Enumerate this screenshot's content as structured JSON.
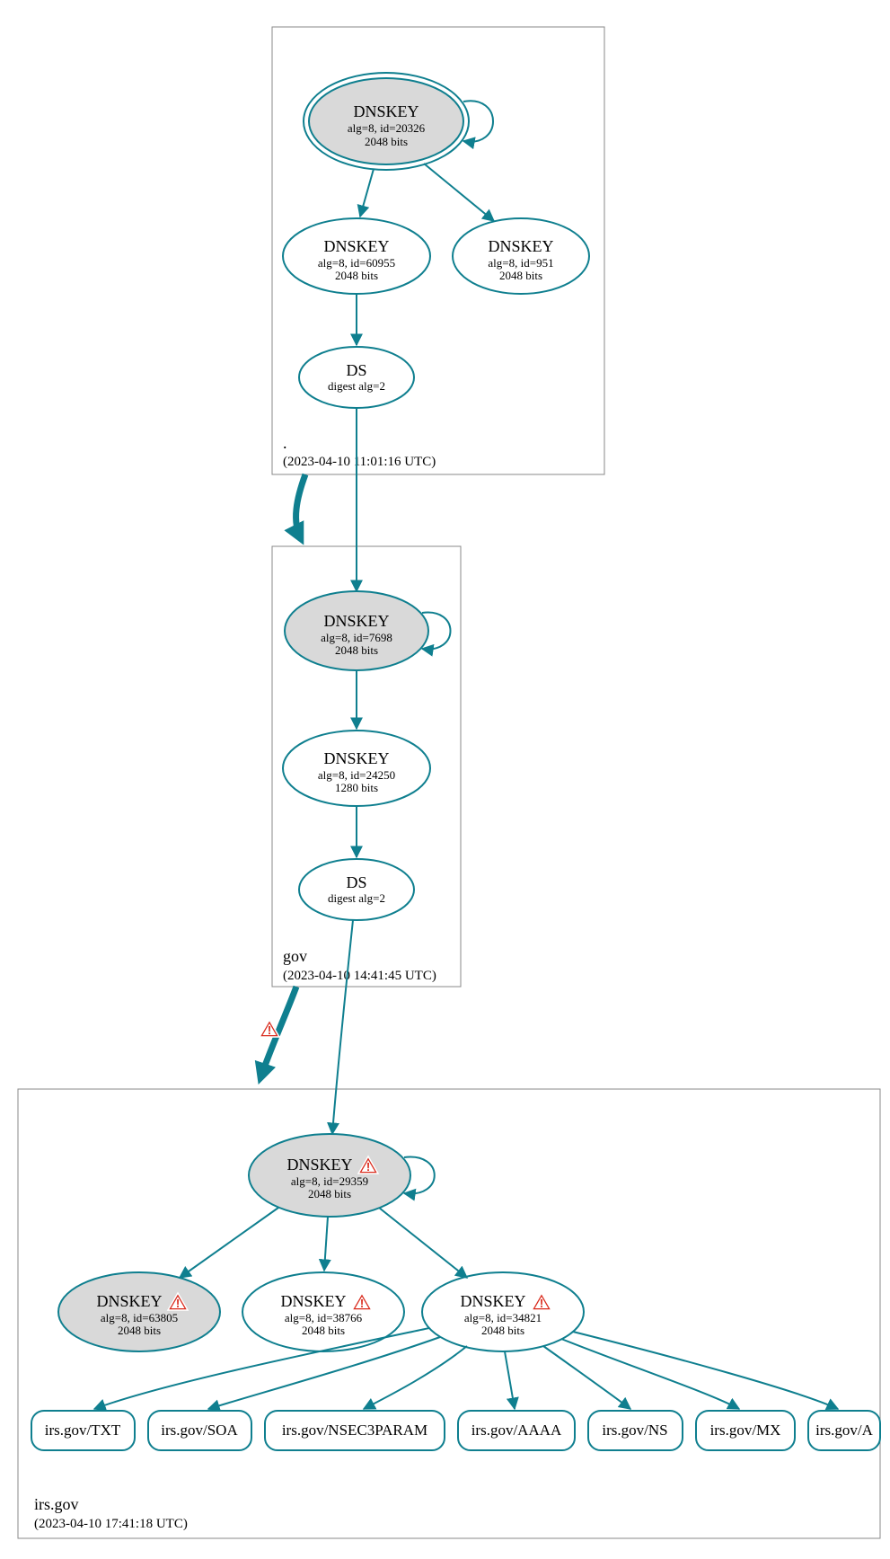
{
  "colors": {
    "stroke": "#0f7f8f",
    "grey": "#d9d9d9",
    "box": "#888888",
    "warn": "#d92a1c"
  },
  "zones": {
    "root": {
      "name": ".",
      "timestamp": "(2023-04-10 11:01:16 UTC)"
    },
    "gov": {
      "name": "gov",
      "timestamp": "(2023-04-10 14:41:45 UTC)"
    },
    "irs": {
      "name": "irs.gov",
      "timestamp": "(2023-04-10 17:41:18 UTC)"
    }
  },
  "nodes": {
    "root_ksk": {
      "title": "DNSKEY",
      "line2": "alg=8, id=20326",
      "line3": "2048 bits"
    },
    "root_zsk1": {
      "title": "DNSKEY",
      "line2": "alg=8, id=60955",
      "line3": "2048 bits"
    },
    "root_zsk2": {
      "title": "DNSKEY",
      "line2": "alg=8, id=951",
      "line3": "2048 bits"
    },
    "root_ds": {
      "title": "DS",
      "line2": "digest alg=2",
      "line3": ""
    },
    "gov_ksk": {
      "title": "DNSKEY",
      "line2": "alg=8, id=7698",
      "line3": "2048 bits"
    },
    "gov_zsk": {
      "title": "DNSKEY",
      "line2": "alg=8, id=24250",
      "line3": "1280 bits"
    },
    "gov_ds": {
      "title": "DS",
      "line2": "digest alg=2",
      "line3": ""
    },
    "irs_ksk": {
      "title": "DNSKEY",
      "line2": "alg=8, id=29359",
      "line3": "2048 bits",
      "warn": true
    },
    "irs_k2": {
      "title": "DNSKEY",
      "line2": "alg=8, id=63805",
      "line3": "2048 bits",
      "warn": true
    },
    "irs_k3": {
      "title": "DNSKEY",
      "line2": "alg=8, id=38766",
      "line3": "2048 bits",
      "warn": true
    },
    "irs_k4": {
      "title": "DNSKEY",
      "line2": "alg=8, id=34821",
      "line3": "2048 bits",
      "warn": true
    }
  },
  "rrsets": {
    "txt": "irs.gov/TXT",
    "soa": "irs.gov/SOA",
    "n3p": "irs.gov/NSEC3PARAM",
    "aaaa": "irs.gov/AAAA",
    "ns": "irs.gov/NS",
    "mx": "irs.gov/MX",
    "a": "irs.gov/A"
  }
}
